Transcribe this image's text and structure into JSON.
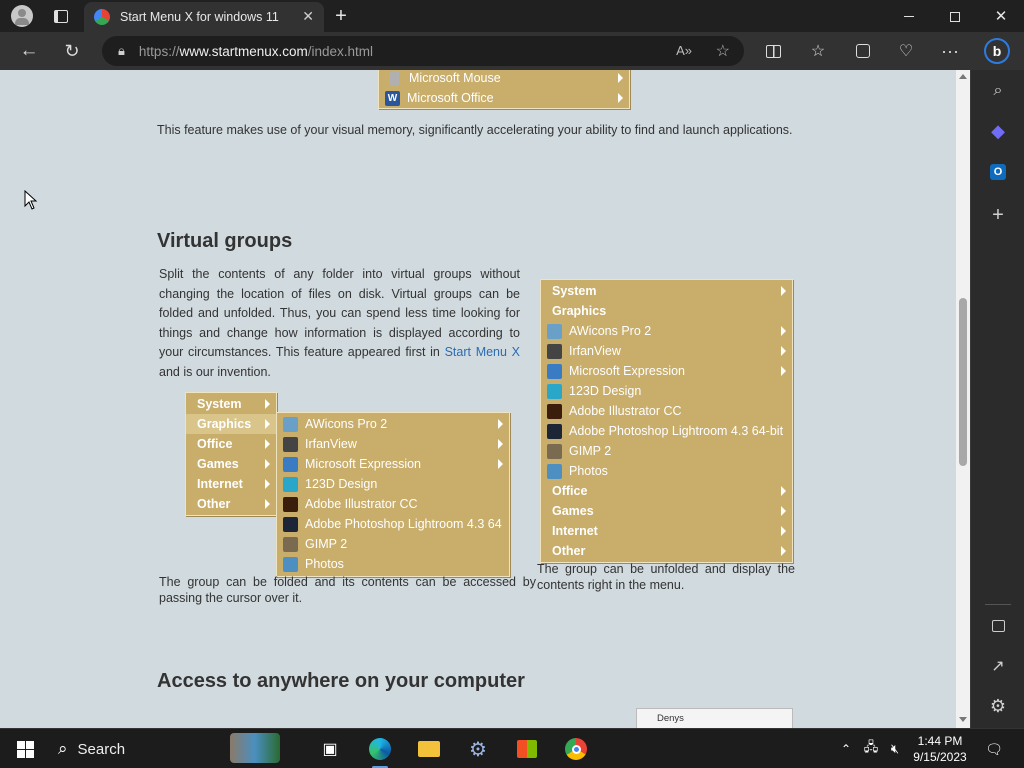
{
  "browser": {
    "tab_title": "Start Menu X for windows 11",
    "url_prefix": "https://",
    "url_domain": "www.startmenux.com",
    "url_path": "/index.html"
  },
  "top_menu": [
    {
      "label": "Microsoft Mouse"
    },
    {
      "label": "Microsoft Office"
    }
  ],
  "content": {
    "intro_text": "This feature makes use of your visual memory, significantly accelerating your ability to find and launch applications.",
    "heading1": "Virtual groups",
    "para_before_link": "Split the contents of any folder into virtual groups without changing the location of files on disk. Virtual groups can be folded and unfolded. Thus, you can spend less time looking for things and change how information is displayed according to your circumstances. This feature appeared first in ",
    "para_link": "Start Menu X",
    "para_after_link": " and is our invention.",
    "caption_left": "The group can be folded and its contents can be accessed by passing the cursor over it.",
    "caption_right": "The group can be unfolded and display the contents right in the menu.",
    "heading2": "Access to anywhere on your computer",
    "peek_label": "Denys"
  },
  "menu_left_groups": [
    "System",
    "Graphics",
    "Office",
    "Games",
    "Internet",
    "Other"
  ],
  "menu_left_selected": "Graphics",
  "menu_sub_items": [
    {
      "label": "AWicons Pro 2",
      "arrow": true,
      "color": "#6aa0c8"
    },
    {
      "label": "IrfanView",
      "arrow": true,
      "color": "#444444"
    },
    {
      "label": "Microsoft Expression",
      "arrow": true,
      "color": "#3a7cc4"
    },
    {
      "label": "123D Design",
      "arrow": false,
      "color": "#2aa6c9"
    },
    {
      "label": "Adobe Illustrator CC",
      "arrow": false,
      "color": "#3b1d0c"
    },
    {
      "label": "Adobe Photoshop Lightroom 4.3 64",
      "arrow": false,
      "color": "#1c2636"
    },
    {
      "label": "GIMP 2",
      "arrow": false,
      "color": "#7a6a50"
    },
    {
      "label": "Photos",
      "arrow": false,
      "color": "#4d8fc0"
    }
  ],
  "menu_right": {
    "groups_top": [
      "System",
      "Graphics"
    ],
    "items": [
      {
        "label": "AWicons Pro 2",
        "arrow": true,
        "color": "#6aa0c8"
      },
      {
        "label": "IrfanView",
        "arrow": true,
        "color": "#444444"
      },
      {
        "label": "Microsoft Expression",
        "arrow": true,
        "color": "#3a7cc4"
      },
      {
        "label": "123D Design",
        "arrow": false,
        "color": "#2aa6c9"
      },
      {
        "label": "Adobe Illustrator CC",
        "arrow": false,
        "color": "#3b1d0c"
      },
      {
        "label": "Adobe Photoshop Lightroom 4.3 64-bit",
        "arrow": false,
        "color": "#1c2636"
      },
      {
        "label": "GIMP 2",
        "arrow": false,
        "color": "#7a6a50"
      },
      {
        "label": "Photos",
        "arrow": false,
        "color": "#4d8fc0"
      }
    ],
    "groups_bottom": [
      "Office",
      "Games",
      "Internet",
      "Other"
    ]
  },
  "taskbar": {
    "search_label": "Search",
    "time": "1:44 PM",
    "date": "9/15/2023"
  },
  "colors": {
    "menu_bg": "#c8ad6b",
    "page_bg": "#d1dadf",
    "link": "#2b6cb0"
  }
}
